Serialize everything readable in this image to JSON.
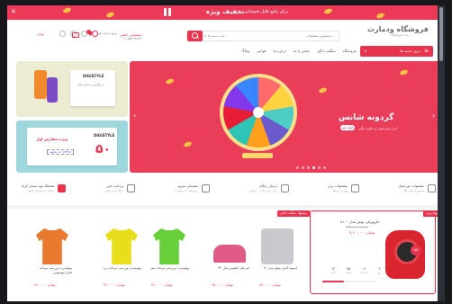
{
  "promo_bar": {
    "close": "✕",
    "big_text": "تخفیف ویژه",
    "small_text": "برای پکیج فایل فتوشاپی"
  },
  "header": {
    "logo": "فروشگاه ودمارت",
    "logo_sub": "ثبت فروشگاه",
    "search_placeholder": "جستجوی محصولات ...",
    "search_category": "همه دسته ها",
    "login": "ورود / ثبت نام",
    "support_label": "پشتیبانی تلفنی",
    "support_phone": "۰۲۱-۵۵۶۶۷۷۸۸",
    "cart_amount": "۰ تومان"
  },
  "nav": {
    "category_button": "مرور دسته ها",
    "links": [
      "فروشگاه",
      "شگفت انگیز",
      "تماس با ما",
      "درباره ما",
      "قوانین",
      "وبلاگ"
    ]
  },
  "hero": {
    "title": "گردونه شانس",
    "subtitle": "بزن بچرخون و جایزه بگیر!",
    "cta": "کلیک کنید",
    "prev": "‹",
    "next": "›",
    "active_slide": 3,
    "slide_count": 6
  },
  "side_banners": {
    "top_brand": "DIGISTYLE",
    "top_text": "بزرگترین حراج سال",
    "bottom_brand": "DIGISTYLE",
    "bottom_text": "ویژه سفارش اول",
    "bottom_value": "۵۰",
    "bottom_code": "کد تخفیف: OFF50"
  },
  "features": [
    {
      "title": "محصولات اورجینال",
      "sub": "تضمین اصالت کالا"
    },
    {
      "title": "محصولات برتر",
      "sub": "بهترین برندها"
    },
    {
      "title": "ارسال رایگان",
      "sub": "برای خرید بالای ۵۰۰ هزار"
    },
    {
      "title": "پشتیبانی سریع",
      "sub": "۷ روز هفته ۲۴ ساعته"
    },
    {
      "title": "پرداخت امن",
      "sub": "درگاه امن بانکی"
    },
    {
      "title": "هماهنگ نوبه نیسان کرایا",
      "sub": "ارسال به سراسر کشور"
    }
  ],
  "amazing": {
    "section_tag": "پیشنهاد شگفت انگیز",
    "box_tag": "پیشنهاد ویژه",
    "title": "جاروبرقی بوش مدل ۸۱۰۰",
    "old_price": "۴,۲۰۰,۰۰۰ تومان",
    "price": "۳,۶۰۰,۰۰۰ تومان",
    "discount": "۱۵٪",
    "timer": [
      {
        "value": "۱۲",
        "label": "ثانیه"
      },
      {
        "value": "۴۵",
        "label": "دقیقه"
      },
      {
        "value": "۰۸",
        "label": "ساعت"
      },
      {
        "value": "۰۲",
        "label": "روز"
      }
    ],
    "sold_progress": 0.4
  },
  "products": [
    {
      "name": "آبمیوه گیری بوش مدل ۱۲",
      "price": "۸۹۰,۰۰۰ تومان",
      "color": "#c7c9cc"
    },
    {
      "name": "اتو بخار فیلیپس مدل ۳۲",
      "price": "۶۵۰,۰۰۰ تومان",
      "color": "#e05a86"
    },
    {
      "name": "پولوشرت ورزشی مردانه سبز",
      "price": "۲۴۰,۰۰۰ تومان",
      "color": "#67cf3a"
    },
    {
      "name": "پولوشرت ورزشی مردانه زرد",
      "price": "۲۳۰,۰۰۰ تومان",
      "color": "#e8de1c"
    },
    {
      "name": "پولوشرت ورزشی مردانه طرح یوونتوس",
      "price": "۲۸۰,۰۰۰ تومان",
      "color": "#e8792e"
    }
  ],
  "colors": {
    "accent": "#e8344f",
    "hero_bg": "#e93d5a"
  }
}
